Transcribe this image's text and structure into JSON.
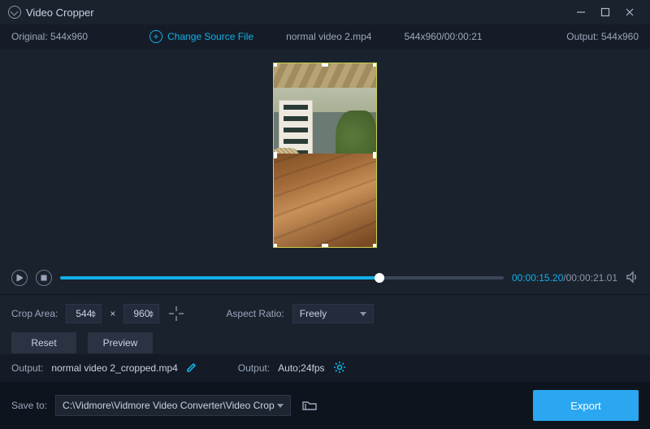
{
  "titlebar": {
    "title": "Video Cropper"
  },
  "infostrip": {
    "original_label": "Original:",
    "original_value": "544x960",
    "change_source": "Change Source File",
    "filename": "normal video 2.mp4",
    "dims_time": "544x960/00:00:21",
    "output_label": "Output:",
    "output_value": "544x960"
  },
  "playback": {
    "current": "00:00:15.20",
    "total": "00:00:21.01"
  },
  "controls": {
    "crop_area_label": "Crop Area:",
    "width": "544",
    "times": "×",
    "height": "960",
    "aspect_label": "Aspect Ratio:",
    "aspect_value": "Freely",
    "reset": "Reset",
    "preview": "Preview"
  },
  "outputbar": {
    "output_label": "Output:",
    "output_file": "normal video 2_cropped.mp4",
    "fmt_label": "Output:",
    "fmt_value": "Auto;24fps"
  },
  "savebar": {
    "save_label": "Save to:",
    "path": "C:\\Vidmore\\Vidmore Video Converter\\Video Crop",
    "export": "Export"
  }
}
